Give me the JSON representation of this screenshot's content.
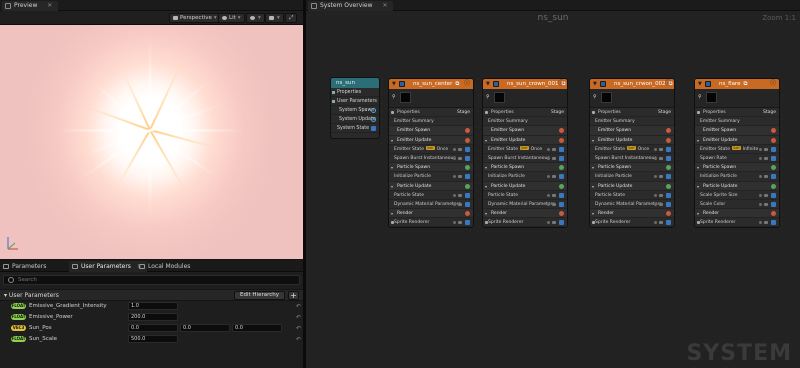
{
  "preview": {
    "tab_label": "Preview",
    "toolbar": {
      "perspective": "Perspective",
      "lit": "Lit"
    }
  },
  "param_tabs": [
    {
      "label": "Parameters"
    },
    {
      "label": "User Parameters"
    },
    {
      "label": "Local Modules"
    }
  ],
  "params": {
    "search_placeholder": "Search",
    "section_label": "User Parameters",
    "edit_hierarchy": "Edit Hierarchy",
    "add": "+",
    "rows": [
      {
        "type": "FLOAT",
        "type_color": "#8fd14f",
        "name": "Emissive_Gradient_Intensity",
        "values": [
          "1.0"
        ]
      },
      {
        "type": "FLOAT",
        "type_color": "#8fd14f",
        "name": "Emissive_Power",
        "values": [
          "200.0"
        ]
      },
      {
        "type": "VEC3",
        "type_color": "#e0c23a",
        "name": "Sun_Pos",
        "values": [
          "0.0",
          "0.0",
          "0.0"
        ]
      },
      {
        "type": "FLOAT",
        "type_color": "#8fd14f",
        "name": "Sun_Scale",
        "values": [
          "500.0"
        ]
      }
    ]
  },
  "system_overview": {
    "tab_label": "System Overview",
    "title": "ns_sun",
    "zoom": "Zoom 1:1",
    "watermark": "SYSTEM",
    "system_node": {
      "name": "ns_sun",
      "rows": [
        "Properties",
        "User Parameters",
        "System Spawn",
        "System Update",
        "System State"
      ]
    },
    "emitters": [
      {
        "name": "ns_sun_center",
        "state_label": "Emitter State",
        "state_badge": "Self",
        "state_value": "Once",
        "sections": [
          "Properties",
          "Emitter Summary",
          "Emitter Spawn",
          "Emitter Update",
          "Spawn Burst Instantaneous",
          "Particle Spawn",
          "Initialize Particle",
          "Particle Update",
          "Particle State",
          "Dynamic Material Parameters",
          "Render",
          "Sprite Renderer"
        ]
      },
      {
        "name": "ns_sun_crown_001",
        "state_label": "Emitter State",
        "state_badge": "Self",
        "state_value": "Once",
        "sections": [
          "Properties",
          "Emitter Summary",
          "Emitter Spawn",
          "Emitter Update",
          "Spawn Burst Instantaneous",
          "Particle Spawn",
          "Initialize Particle",
          "Particle Update",
          "Particle State",
          "Dynamic Material Parameters",
          "Render",
          "Sprite Renderer"
        ]
      },
      {
        "name": "ns_sun_crwon_002",
        "state_label": "Emitter State",
        "state_badge": "Self",
        "state_value": "Once",
        "sections": [
          "Properties",
          "Emitter Summary",
          "Emitter Spawn",
          "Emitter Update",
          "Spawn Burst Instantaneous",
          "Particle Spawn",
          "Initialize Particle",
          "Particle Update",
          "Particle State",
          "Dynamic Material Parameters",
          "Render",
          "Sprite Renderer"
        ]
      },
      {
        "name": "ns_flare",
        "state_label": "Emitter State",
        "state_badge": "Self",
        "state_value": "Infinite",
        "sections": [
          "Properties",
          "Emitter Summary",
          "Emitter Spawn",
          "Emitter Update",
          "Spawn Rate",
          "Particle Spawn",
          "Initialize Particle",
          "Particle Update",
          "Scale Sprite Size",
          "Scale Color",
          "Render",
          "Sprite Renderer"
        ]
      }
    ],
    "stage_label": "Stage"
  }
}
